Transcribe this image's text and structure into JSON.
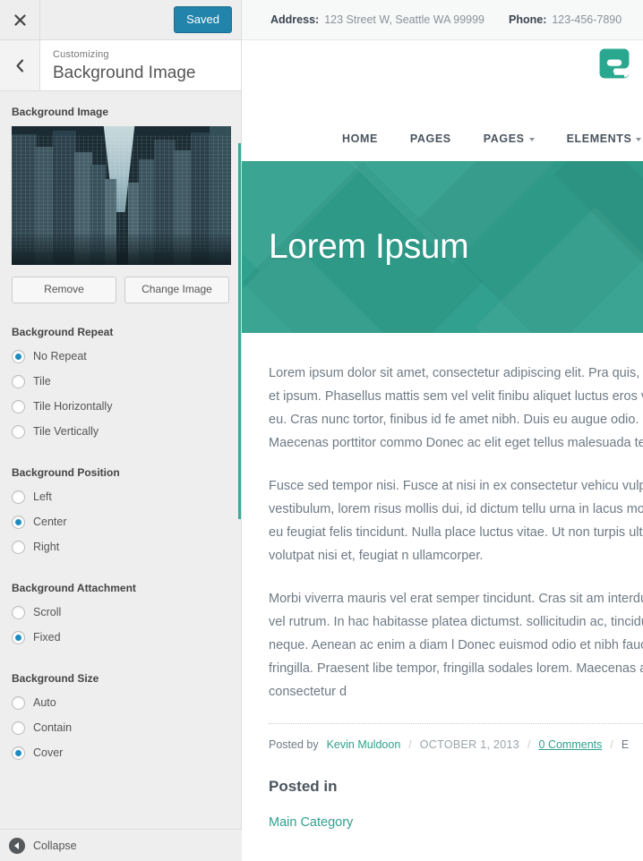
{
  "customizer": {
    "close_icon": "close-icon",
    "save_button": "Saved",
    "back_icon": "chevron-left-icon",
    "eyebrow": "Customizing",
    "panel_title": "Background Image",
    "collapse_label": "Collapse",
    "accent_blue": "#1e8cbe",
    "save_bg": "#2283ab",
    "controls": {
      "image_label": "Background Image",
      "remove_button": "Remove",
      "change_button": "Change Image",
      "groups": [
        {
          "label": "Background Repeat",
          "options": [
            {
              "label": "No Repeat",
              "selected": true
            },
            {
              "label": "Tile",
              "selected": false
            },
            {
              "label": "Tile Horizontally",
              "selected": false
            },
            {
              "label": "Tile Vertically",
              "selected": false
            }
          ]
        },
        {
          "label": "Background Position",
          "options": [
            {
              "label": "Left",
              "selected": false
            },
            {
              "label": "Center",
              "selected": true
            },
            {
              "label": "Right",
              "selected": false
            }
          ]
        },
        {
          "label": "Background Attachment",
          "options": [
            {
              "label": "Scroll",
              "selected": false
            },
            {
              "label": "Fixed",
              "selected": true
            }
          ]
        },
        {
          "label": "Background Size",
          "options": [
            {
              "label": "Auto",
              "selected": false
            },
            {
              "label": "Contain",
              "selected": false
            },
            {
              "label": "Cover",
              "selected": true
            }
          ]
        }
      ]
    }
  },
  "preview": {
    "topbar": {
      "address_label": "Address:",
      "address_value": "123 Street W, Seattle WA 99999",
      "phone_label": "Phone:",
      "phone_value": "123-456-7890"
    },
    "logo_name": "site-logo-e-icon",
    "brand_color": "#2aa88f",
    "nav": [
      {
        "label": "HOME",
        "has_caret": false
      },
      {
        "label": "PAGES",
        "has_caret": false
      },
      {
        "label": "PAGES",
        "has_caret": true
      },
      {
        "label": "ELEMENTS",
        "has_caret": true
      }
    ],
    "hero": {
      "title": "Lorem Ipsum",
      "bg_color": "#31a08e"
    },
    "article": {
      "paragraphs": [
        "Lorem ipsum dolor sit amet, consectetur adipiscing elit. Pra quis, dapibus et ipsum. Phasellus mattis sem vel velit finibu aliquet luctus eros viverra eu. Cras nunc tortor, finibus id fe amet nibh. Duis eu augue odio. Maecenas porttitor commo Donec ac elit eget tellus malesuada tempus.",
        "Fusce sed tempor nisi. Fusce at nisi in ex consectetur vehicu vulputate vestibulum, lorem risus mollis dui, id dictum tellu urna in lacus molestie, eu feugiat felis tincidunt. Nulla place luctus vitae. Ut non turpis ultrices, volutpat nisi et, feugiat n ullamcorper.",
        "Morbi viverra mauris vel erat semper tincidunt. Cras sit am interdum dui vel rutrum. In hac habitasse platea dictumst. sollicitudin ac, tincidunt in neque. Aenean ac enim a diam l Donec euismod odio et nibh faucibus fringilla. Praesent libe tempor, fringilla sodales lorem. Maecenas at consectetur d"
      ],
      "meta": {
        "posted_by_label": "Posted by",
        "author": "Kevin Muldoon",
        "separator": "/",
        "date": "OCTOBER 1, 2013",
        "comments": "0 Comments",
        "extra": "E"
      },
      "posted_in_heading": "Posted in",
      "category": "Main Category"
    }
  }
}
